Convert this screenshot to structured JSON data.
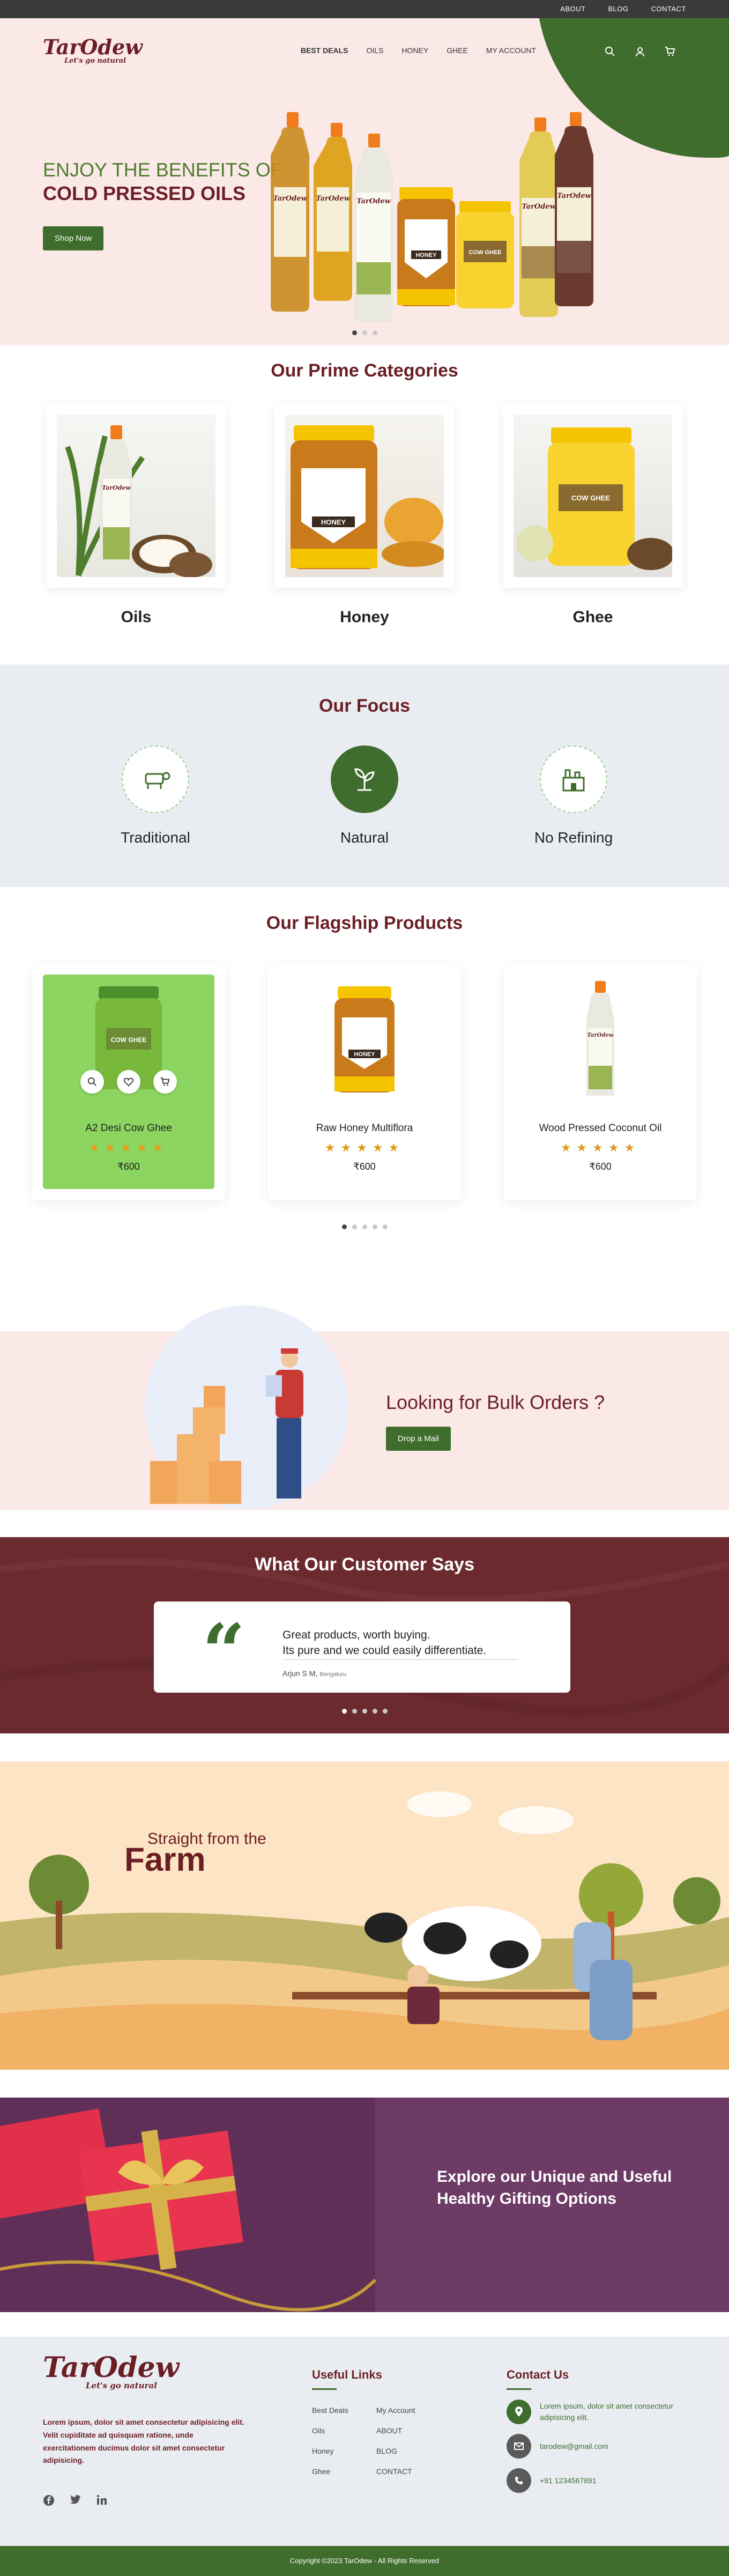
{
  "topbar": {
    "about": "ABOUT",
    "blog": "BLOG",
    "contact": "CONTACT"
  },
  "logo": {
    "name": "TarOdew",
    "tagline": "Let's go natural"
  },
  "nav": {
    "items": [
      "BEST DEALS",
      "OILS",
      "HONEY",
      "GHEE",
      "MY ACCOUNT"
    ]
  },
  "icons": {
    "search": "search-icon",
    "account": "user-icon",
    "cart": "cart-icon"
  },
  "hero": {
    "line1": "ENJOY THE BENEFITS OF",
    "line2": "COLD PRESSED OILS",
    "cta": "Shop Now",
    "product_labels": [
      "TarOdew",
      "TarOdew",
      "TarOdew",
      "TarOdew",
      "HONEY",
      "COW GHEE",
      "TarOdew",
      "TarOdew"
    ]
  },
  "categories": {
    "title": "Our Prime Categories",
    "items": [
      {
        "label": "Oils",
        "product_text": "TarOdew"
      },
      {
        "label": "Honey",
        "product_text": "HONEY"
      },
      {
        "label": "Ghee",
        "product_text": "COW GHEE"
      }
    ]
  },
  "focus": {
    "title": "Our Focus",
    "items": [
      "Traditional",
      "Natural",
      "No Refining"
    ]
  },
  "flagship": {
    "title": "Our Flagship Products",
    "products": [
      {
        "name": "A2 Desi Cow Ghee",
        "price": "₹600",
        "stars": "★★★★★",
        "pack_text": "COW GHEE"
      },
      {
        "name": "Raw Honey Multiflora",
        "price": "₹600",
        "stars": "★★★★★",
        "pack_text": "HONEY"
      },
      {
        "name": "Wood Pressed Coconut Oil",
        "price": "₹600",
        "stars": "★★★★★",
        "pack_text": "TarOdew"
      }
    ]
  },
  "bulk": {
    "title": "Looking for Bulk Orders ?",
    "cta": "Drop a Mail"
  },
  "testimonial": {
    "title": "What Our Customer Says",
    "quote_line1": "Great products, worth buying.",
    "quote_line2": "Its pure and we could easily differentiate.",
    "author": "Arjun S M,",
    "city": "Bengaluru"
  },
  "farm": {
    "line1": "Straight from the",
    "line2": "Farm"
  },
  "gifting": {
    "line1": "Explore our Unique and Useful",
    "line2": "Healthy Gifting Options"
  },
  "footer": {
    "about": "Lorem ipsum, dolor sit amet consectetur adipisicing elit. Velit cupiditate ad quisquam ratione, unde exercitationem ducimus dolor sit amet consectetur adipisicing.",
    "links_title": "Useful Links",
    "links": [
      "Best Deals",
      "My Account",
      "Oils",
      "ABOUT",
      "Honey",
      "BLOG",
      "Ghee",
      "CONTACT"
    ],
    "contact_title": "Contact Us",
    "address": "Lorem ipsum, dolor sit amet consectetur adipisicing elit.",
    "email": "tarodew@gmail.com",
    "phone": "+91 1234567891",
    "copyright": "Copyright ©2023 TarOdew - All Rights Reserved"
  },
  "colors": {
    "brand_green": "#3f6d2d",
    "brand_maroon": "#6b1f25",
    "hero_bg": "#fbe9e8",
    "focus_bg": "#e9edf1",
    "testimonial_bg": "#6b2a2e"
  }
}
